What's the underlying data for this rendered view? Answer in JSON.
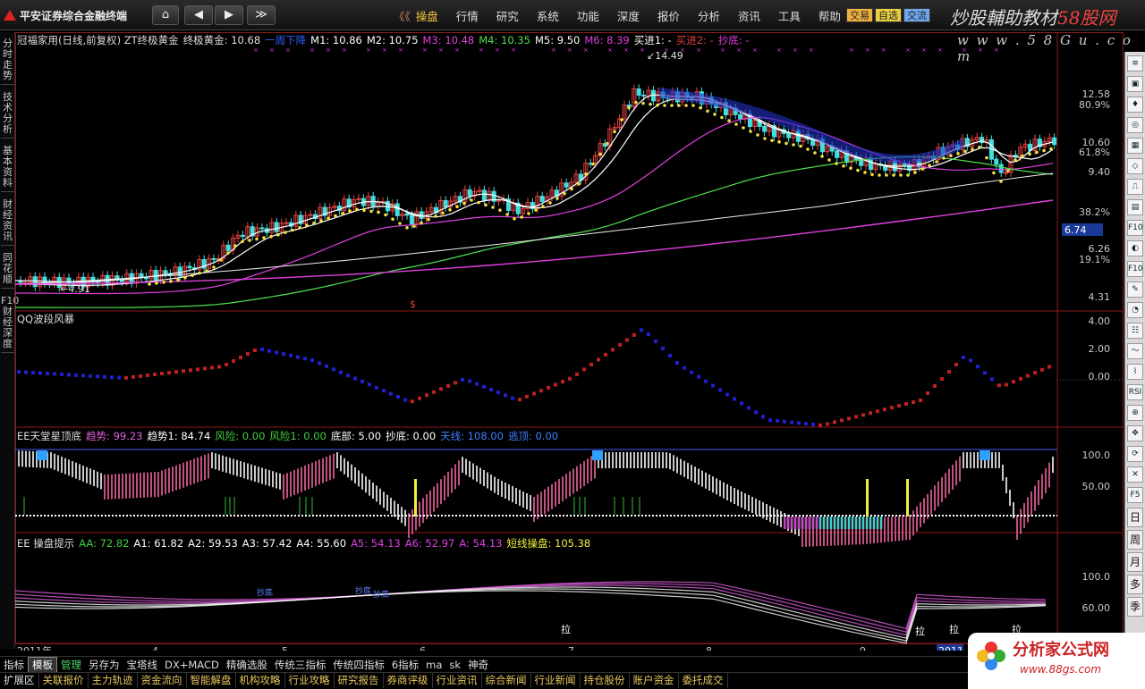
{
  "top": {
    "brand": "平安证券综合金融终端",
    "nav": [
      "⌂",
      "◀",
      "▶",
      "≫"
    ],
    "menu": [
      "《《",
      "操盘",
      "行情",
      "研究",
      "系统",
      "功能",
      "深度",
      "报价",
      "分析",
      "资讯",
      "工具",
      "帮助"
    ],
    "buttons": [
      {
        "label": "交易",
        "bg": "#f0b040"
      },
      {
        "label": "自选",
        "bg": "#e8d040"
      },
      {
        "label": "交流",
        "bg": "#70a8f0"
      }
    ],
    "watermark_prefix": "炒股輔助教材",
    "watermark_red": "58股网",
    "watermark_url": "w w w . 5 8 G u . c o m"
  },
  "left_tabs": [
    "分时走势",
    "技术分析",
    "基本资料",
    "财经资讯",
    "同花顺",
    "F10财经深度"
  ],
  "right_tools": [
    "≡",
    "▣",
    "♦",
    "◎",
    "▦",
    "◇",
    "⎍",
    "▤",
    "F10",
    "◐",
    "F10",
    "✎",
    "◔",
    "☷",
    "～",
    "⌇",
    "RSI",
    "⊕",
    "✥",
    "⟳",
    "✕",
    "F5",
    "日",
    "周",
    "月",
    "多",
    "季"
  ],
  "main_header": {
    "title": "冠福家用(日线,前复权) ZT终极黄金",
    "items": [
      {
        "label": "终极黄金: 10.68",
        "color": "#e0e0e0"
      },
      {
        "label": "一周下降",
        "color": "#2f5fff"
      },
      {
        "label": "M1: 10.86",
        "color": "#ffffff"
      },
      {
        "label": "M2: 10.75",
        "color": "#ffffff"
      },
      {
        "label": "M3: 10.48",
        "color": "#e040e0"
      },
      {
        "label": "M4: 10.35",
        "color": "#50e050"
      },
      {
        "label": "M5: 9.50",
        "color": "#ffffff"
      },
      {
        "label": "M6: 8.39",
        "color": "#e040e0"
      },
      {
        "label": "买进1: -",
        "color": "#ffffff"
      },
      {
        "label": "买进2: -",
        "color": "#e04040"
      },
      {
        "label": "抄底: -",
        "color": "#e040e0"
      }
    ],
    "y_labels": [
      "12.58",
      "80.9%",
      "10.60",
      "61.8%",
      "9.40",
      "38.2%",
      "6.74",
      "6.26",
      "19.1%",
      "4.31"
    ],
    "high_label": "14.49",
    "low_label": "4.91",
    "s_marker": "$"
  },
  "qq_header": {
    "title": "QQ波段风暴",
    "y_labels": [
      "4.00",
      "2.00",
      "0.00"
    ]
  },
  "ee1_header": {
    "title": "EE天堂星顶底",
    "items": [
      {
        "label": "趋势: 99.23",
        "color": "#e060e0"
      },
      {
        "label": "趋势1: 84.74",
        "color": "#ffffff"
      },
      {
        "label": "风险: 0.00",
        "color": "#40d040"
      },
      {
        "label": "风险1: 0.00",
        "color": "#40d040"
      },
      {
        "label": "底部: 5.00",
        "color": "#ffffff"
      },
      {
        "label": "抄底: 0.00",
        "color": "#ffffff"
      },
      {
        "label": "天线: 108.00",
        "color": "#4080ff"
      },
      {
        "label": "逃顶: 0.00",
        "color": "#4080ff"
      }
    ],
    "y_labels": [
      "100.0",
      "50.00"
    ]
  },
  "ee2_header": {
    "title": "EE 操盘提示",
    "items": [
      {
        "label": "AA: 72.82",
        "color": "#40d040"
      },
      {
        "label": "A1: 61.82",
        "color": "#ffffff"
      },
      {
        "label": "A2: 59.53",
        "color": "#ffffff"
      },
      {
        "label": "A3: 57.42",
        "color": "#ffffff"
      },
      {
        "label": "A4: 55.60",
        "color": "#ffffff"
      },
      {
        "label": "A5: 54.13",
        "color": "#e040e0"
      },
      {
        "label": "A6: 52.97",
        "color": "#e040e0"
      },
      {
        "label": "A: 54.13",
        "color": "#e040e0"
      },
      {
        "label": "短线操盘: 105.38",
        "color": "#f0f040"
      }
    ],
    "y_labels": [
      "100.0",
      "60.00"
    ],
    "annotations": [
      "拉",
      "拉",
      "拉",
      "拉",
      "抄底",
      "抄底",
      "抄底"
    ]
  },
  "x_axis": {
    "labels": [
      "2011年",
      "4",
      "5",
      "6",
      "7",
      "8",
      "9",
      "2011"
    ]
  },
  "bottom_tabs1": [
    "指标",
    "模板",
    "管理",
    "另存为",
    "宝塔线",
    "DX+MACD",
    "精确选股",
    "传统三指标",
    "传统四指标",
    "6指标",
    "ma",
    "sk",
    "神奇"
  ],
  "bottom_tabs2": [
    "扩展区",
    "关联报价",
    "主力轨迹",
    "资金流向",
    "智能解盘",
    "机构攻略",
    "行业攻略",
    "研究报告",
    "券商评级",
    "行业资讯",
    "综合新闻",
    "行业新闻",
    "持仓股份",
    "账户资金",
    "委托成交"
  ],
  "logo88": {
    "title": "分析家公式网",
    "sub": "www.88gs.com"
  }
}
